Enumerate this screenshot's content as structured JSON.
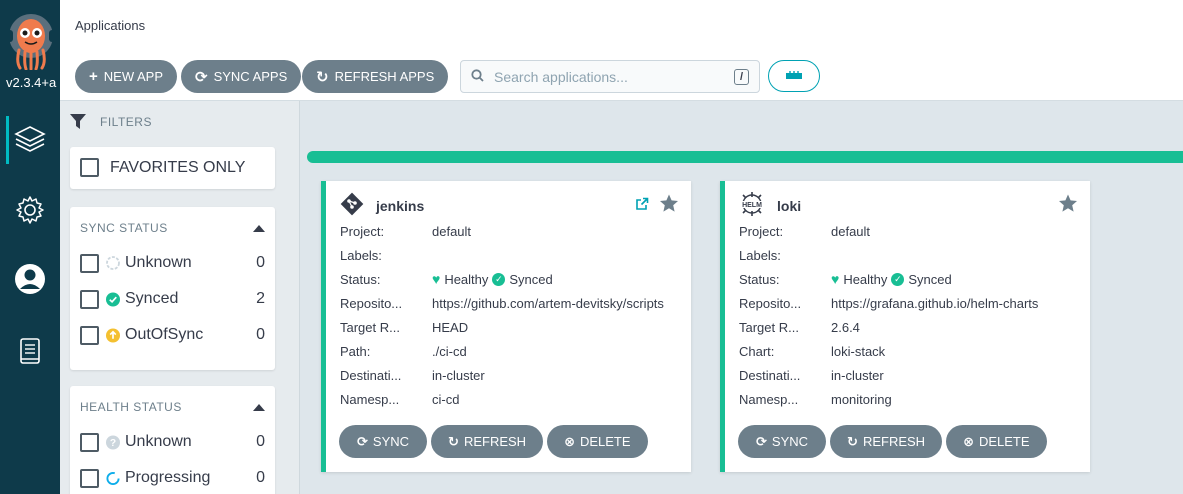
{
  "nav": {
    "version": "v2.3.4+a",
    "items": [
      {
        "name": "applications",
        "icon": "layers-icon"
      },
      {
        "name": "settings",
        "icon": "gear-icon"
      },
      {
        "name": "user-info",
        "icon": "user-icon"
      },
      {
        "name": "documentation",
        "icon": "book-icon"
      }
    ]
  },
  "header": {
    "title": "Applications"
  },
  "toolbar": {
    "new_app": "NEW APP",
    "sync_apps": "SYNC APPS",
    "refresh_apps": "REFRESH APPS",
    "search_placeholder": "Search applications...",
    "search_shortcut": "/"
  },
  "filters": {
    "title": "FILTERS",
    "favorites_only": "FAVORITES ONLY",
    "sync_status": {
      "title": "SYNC STATUS",
      "items": [
        {
          "label": "Unknown",
          "count": "0"
        },
        {
          "label": "Synced",
          "count": "2"
        },
        {
          "label": "OutOfSync",
          "count": "0"
        }
      ]
    },
    "health_status": {
      "title": "HEALTH STATUS",
      "items": [
        {
          "label": "Unknown",
          "count": "0"
        },
        {
          "label": "Progressing",
          "count": "0"
        }
      ]
    }
  },
  "apps": [
    {
      "name": "jenkins",
      "source_icon": "git-icon",
      "rows": [
        {
          "key": "Project:",
          "value": "default"
        },
        {
          "key": "Labels:",
          "value": ""
        },
        {
          "key": "Status:",
          "health": "Healthy",
          "sync": "Synced"
        },
        {
          "key": "Reposito...",
          "value": "https://github.com/artem-devitsky/scripts"
        },
        {
          "key": "Target R...",
          "value": "HEAD"
        },
        {
          "key": "Path:",
          "value": "./ci-cd"
        },
        {
          "key": "Destinati...",
          "value": "in-cluster"
        },
        {
          "key": "Namesp...",
          "value": "ci-cd"
        }
      ]
    },
    {
      "name": "loki",
      "source_icon": "helm-icon",
      "rows": [
        {
          "key": "Project:",
          "value": "default"
        },
        {
          "key": "Labels:",
          "value": ""
        },
        {
          "key": "Status:",
          "health": "Healthy",
          "sync": "Synced"
        },
        {
          "key": "Reposito...",
          "value": "https://grafana.github.io/helm-charts"
        },
        {
          "key": "Target R...",
          "value": "2.6.4"
        },
        {
          "key": "Chart:",
          "value": "loki-stack"
        },
        {
          "key": "Destinati...",
          "value": "in-cluster"
        },
        {
          "key": "Namesp...",
          "value": "monitoring"
        }
      ]
    }
  ],
  "card_actions": {
    "sync": "SYNC",
    "refresh": "REFRESH",
    "delete": "DELETE"
  },
  "colors": {
    "nav_bg": "#0e3a4a",
    "accent": "#18be94",
    "button_bg": "#6d7f8b",
    "teal": "#00a2b3"
  }
}
